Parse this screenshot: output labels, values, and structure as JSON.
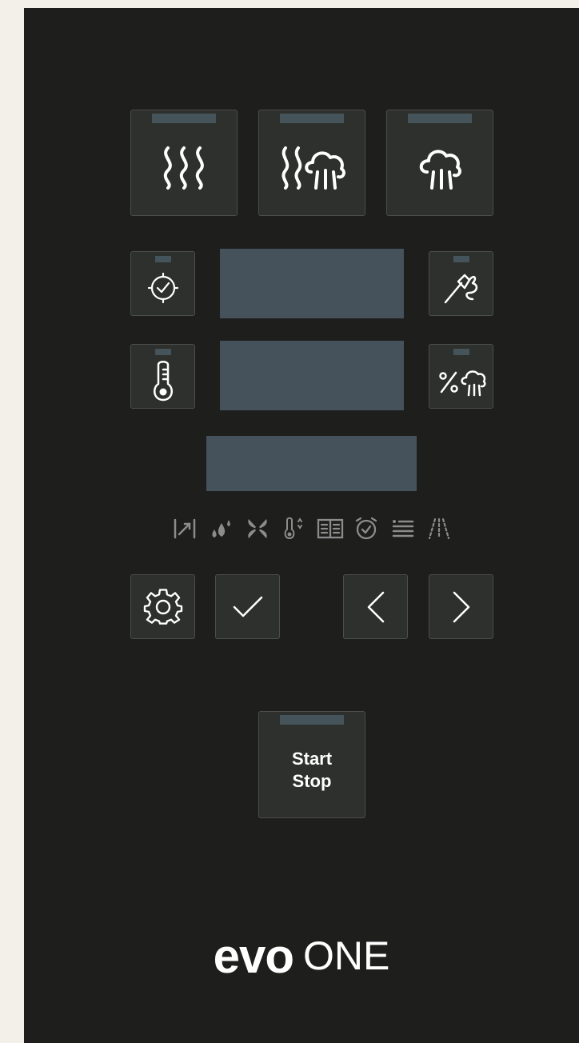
{
  "panel": {
    "brand": {
      "strong": "evo",
      "light": "ONE"
    }
  },
  "mode_buttons": [
    {
      "name": "convection-mode-button",
      "icon": "convection-heat-icon"
    },
    {
      "name": "combi-mode-button",
      "icon": "combi-heat-steam-icon"
    },
    {
      "name": "steam-mode-button",
      "icon": "steam-icon"
    }
  ],
  "side_buttons": {
    "timer": {
      "icon": "timer-icon"
    },
    "core_probe": {
      "icon": "core-probe-icon"
    },
    "temperature": {
      "icon": "thermometer-icon"
    },
    "humidity": {
      "icon": "humidity-percent-icon"
    }
  },
  "status_icons": [
    "preheat-icon",
    "humidity-drops-icon",
    "fan-icon",
    "core-temp-icon",
    "recipe-book-icon",
    "alarm-clock-icon",
    "program-list-icon",
    "cleaning-spray-icon"
  ],
  "nav_buttons": {
    "settings": {
      "icon": "gear-icon"
    },
    "confirm": {
      "icon": "check-icon"
    },
    "previous": {
      "icon": "chevron-left-icon"
    },
    "next": {
      "icon": "chevron-right-icon"
    }
  },
  "start_stop": {
    "label": "Start\nStop"
  },
  "colors": {
    "panel": "#1e1e1d",
    "button": "#2d302c",
    "display": "#45525b",
    "icon": "#ffffff",
    "status_icon": "#8c8c8c"
  }
}
